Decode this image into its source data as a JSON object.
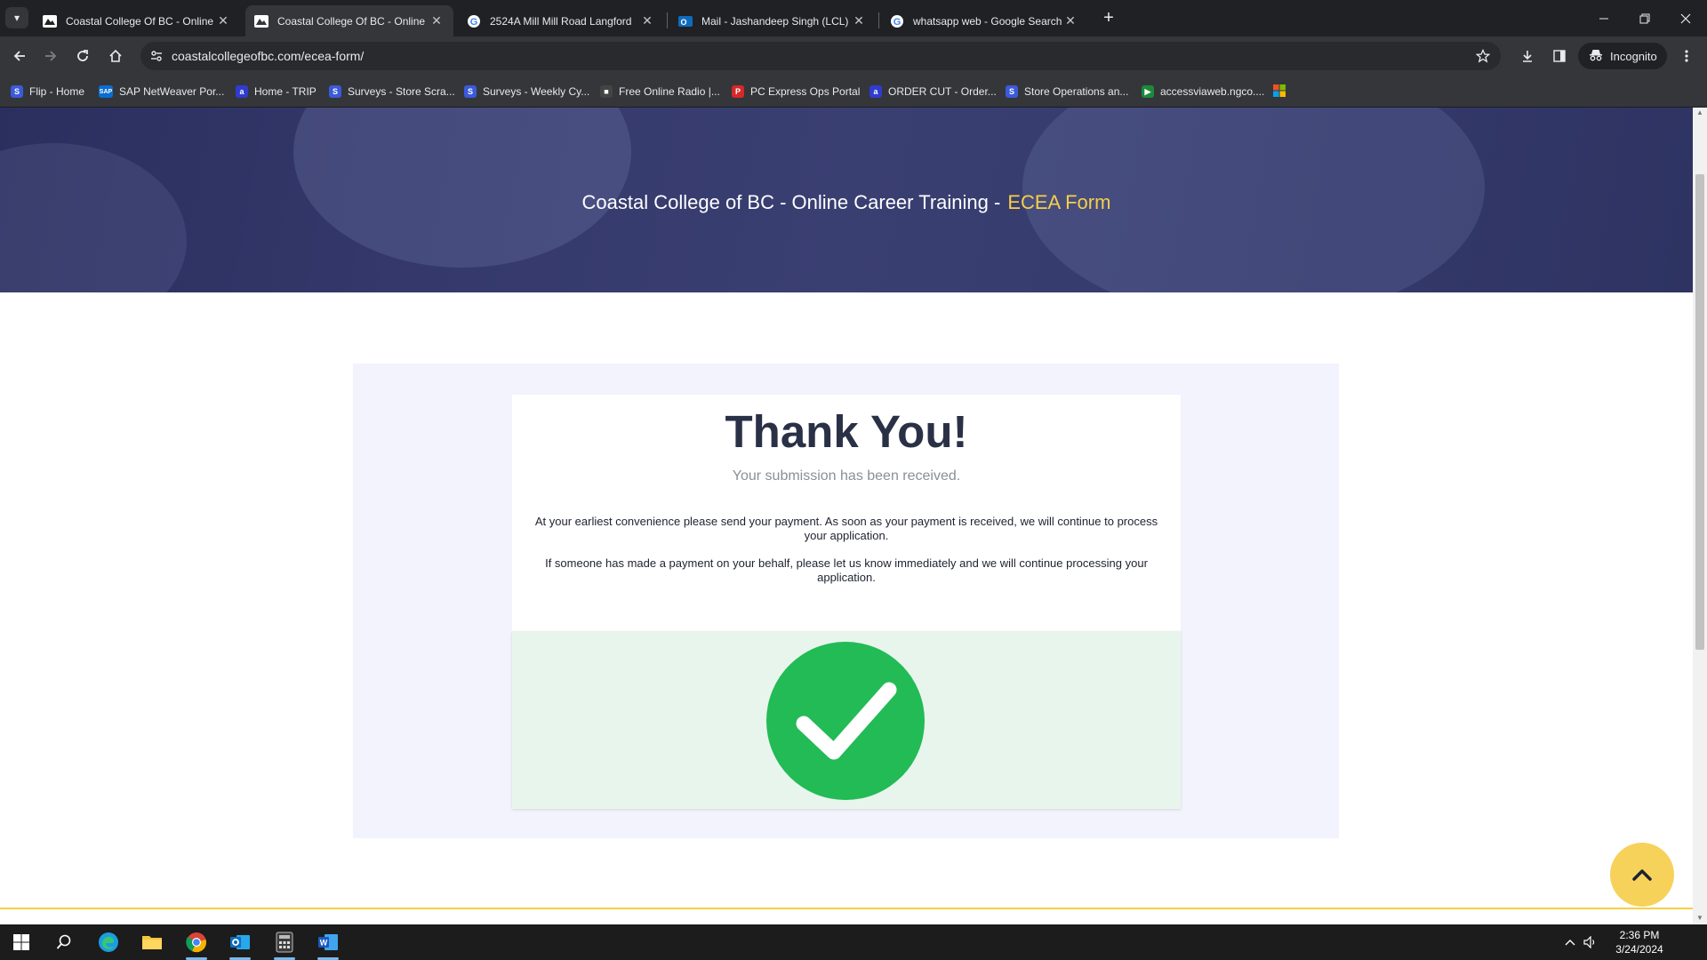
{
  "browser": {
    "tabs": [
      {
        "title": "Coastal College Of BC - Online",
        "active": false,
        "favicon": "mountain-icon"
      },
      {
        "title": "Coastal College Of BC - Online",
        "active": true,
        "favicon": "mountain-icon"
      },
      {
        "title": "2524A Mill Mill Road Langford",
        "active": false,
        "favicon": "google-icon"
      },
      {
        "title": "Mail - Jashandeep Singh (LCL) -",
        "active": false,
        "favicon": "outlook-icon"
      },
      {
        "title": "whatsapp web - Google Search",
        "active": false,
        "favicon": "google-icon"
      }
    ],
    "url": "coastalcollegeofbc.com/ecea-form/",
    "incognito_label": "Incognito",
    "bookmarks": [
      {
        "label": "Flip - Home"
      },
      {
        "label": "SAP NetWeaver Por..."
      },
      {
        "label": "Home - TRIP"
      },
      {
        "label": "Surveys - Store Scra..."
      },
      {
        "label": "Surveys - Weekly Cy..."
      },
      {
        "label": "Free Online Radio |..."
      },
      {
        "label": "PC Express Ops Portal"
      },
      {
        "label": "ORDER CUT - Order..."
      },
      {
        "label": "Store Operations an..."
      },
      {
        "label": "accessviaweb.ngco...."
      }
    ]
  },
  "page": {
    "hero": {
      "title": "Coastal College of BC - Online Career Training -",
      "highlight": "ECEA Form"
    },
    "thankyou": {
      "heading": "Thank You!",
      "subheading": "Your submission has been received.",
      "message_1": "At your earliest convenience please send your payment. As soon as your payment is received, we will continue to process your application.",
      "message_2": "If someone has made a payment on your behalf, please let us know immediately and we will continue processing your application."
    },
    "colors": {
      "accent_yellow": "#f6cf48",
      "success_green": "#22bb55",
      "hero_navy": "#343a6b"
    }
  },
  "taskbar": {
    "time": "2:36 PM",
    "date": "3/24/2024"
  }
}
